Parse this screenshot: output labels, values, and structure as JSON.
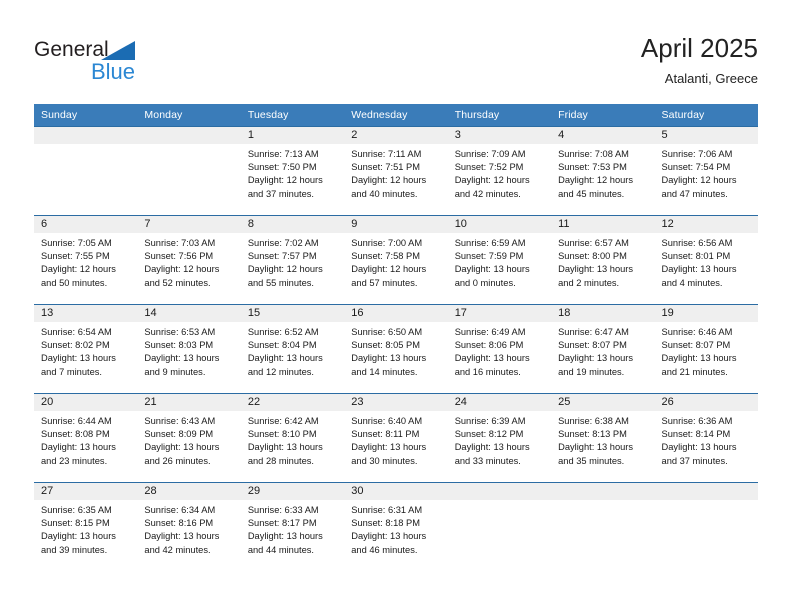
{
  "brand": {
    "name_part1": "General",
    "name_part2": "Blue"
  },
  "header": {
    "title": "April 2025",
    "subtitle": "Atalanti, Greece"
  },
  "colors": {
    "header_blue": "#3a7cb9",
    "row_rule_blue": "#2b6ca3",
    "daynum_band": "#efefef",
    "logo_blue": "#2b87d3",
    "logo_triangle": "#1b6cb3"
  },
  "weekdays": [
    "Sunday",
    "Monday",
    "Tuesday",
    "Wednesday",
    "Thursday",
    "Friday",
    "Saturday"
  ],
  "weeks": [
    [
      {
        "day": "",
        "lines": []
      },
      {
        "day": "",
        "lines": []
      },
      {
        "day": "1",
        "lines": [
          "Sunrise: 7:13 AM",
          "Sunset: 7:50 PM",
          "Daylight: 12 hours",
          "and 37 minutes."
        ]
      },
      {
        "day": "2",
        "lines": [
          "Sunrise: 7:11 AM",
          "Sunset: 7:51 PM",
          "Daylight: 12 hours",
          "and 40 minutes."
        ]
      },
      {
        "day": "3",
        "lines": [
          "Sunrise: 7:09 AM",
          "Sunset: 7:52 PM",
          "Daylight: 12 hours",
          "and 42 minutes."
        ]
      },
      {
        "day": "4",
        "lines": [
          "Sunrise: 7:08 AM",
          "Sunset: 7:53 PM",
          "Daylight: 12 hours",
          "and 45 minutes."
        ]
      },
      {
        "day": "5",
        "lines": [
          "Sunrise: 7:06 AM",
          "Sunset: 7:54 PM",
          "Daylight: 12 hours",
          "and 47 minutes."
        ]
      }
    ],
    [
      {
        "day": "6",
        "lines": [
          "Sunrise: 7:05 AM",
          "Sunset: 7:55 PM",
          "Daylight: 12 hours",
          "and 50 minutes."
        ]
      },
      {
        "day": "7",
        "lines": [
          "Sunrise: 7:03 AM",
          "Sunset: 7:56 PM",
          "Daylight: 12 hours",
          "and 52 minutes."
        ]
      },
      {
        "day": "8",
        "lines": [
          "Sunrise: 7:02 AM",
          "Sunset: 7:57 PM",
          "Daylight: 12 hours",
          "and 55 minutes."
        ]
      },
      {
        "day": "9",
        "lines": [
          "Sunrise: 7:00 AM",
          "Sunset: 7:58 PM",
          "Daylight: 12 hours",
          "and 57 minutes."
        ]
      },
      {
        "day": "10",
        "lines": [
          "Sunrise: 6:59 AM",
          "Sunset: 7:59 PM",
          "Daylight: 13 hours",
          "and 0 minutes."
        ]
      },
      {
        "day": "11",
        "lines": [
          "Sunrise: 6:57 AM",
          "Sunset: 8:00 PM",
          "Daylight: 13 hours",
          "and 2 minutes."
        ]
      },
      {
        "day": "12",
        "lines": [
          "Sunrise: 6:56 AM",
          "Sunset: 8:01 PM",
          "Daylight: 13 hours",
          "and 4 minutes."
        ]
      }
    ],
    [
      {
        "day": "13",
        "lines": [
          "Sunrise: 6:54 AM",
          "Sunset: 8:02 PM",
          "Daylight: 13 hours",
          "and 7 minutes."
        ]
      },
      {
        "day": "14",
        "lines": [
          "Sunrise: 6:53 AM",
          "Sunset: 8:03 PM",
          "Daylight: 13 hours",
          "and 9 minutes."
        ]
      },
      {
        "day": "15",
        "lines": [
          "Sunrise: 6:52 AM",
          "Sunset: 8:04 PM",
          "Daylight: 13 hours",
          "and 12 minutes."
        ]
      },
      {
        "day": "16",
        "lines": [
          "Sunrise: 6:50 AM",
          "Sunset: 8:05 PM",
          "Daylight: 13 hours",
          "and 14 minutes."
        ]
      },
      {
        "day": "17",
        "lines": [
          "Sunrise: 6:49 AM",
          "Sunset: 8:06 PM",
          "Daylight: 13 hours",
          "and 16 minutes."
        ]
      },
      {
        "day": "18",
        "lines": [
          "Sunrise: 6:47 AM",
          "Sunset: 8:07 PM",
          "Daylight: 13 hours",
          "and 19 minutes."
        ]
      },
      {
        "day": "19",
        "lines": [
          "Sunrise: 6:46 AM",
          "Sunset: 8:07 PM",
          "Daylight: 13 hours",
          "and 21 minutes."
        ]
      }
    ],
    [
      {
        "day": "20",
        "lines": [
          "Sunrise: 6:44 AM",
          "Sunset: 8:08 PM",
          "Daylight: 13 hours",
          "and 23 minutes."
        ]
      },
      {
        "day": "21",
        "lines": [
          "Sunrise: 6:43 AM",
          "Sunset: 8:09 PM",
          "Daylight: 13 hours",
          "and 26 minutes."
        ]
      },
      {
        "day": "22",
        "lines": [
          "Sunrise: 6:42 AM",
          "Sunset: 8:10 PM",
          "Daylight: 13 hours",
          "and 28 minutes."
        ]
      },
      {
        "day": "23",
        "lines": [
          "Sunrise: 6:40 AM",
          "Sunset: 8:11 PM",
          "Daylight: 13 hours",
          "and 30 minutes."
        ]
      },
      {
        "day": "24",
        "lines": [
          "Sunrise: 6:39 AM",
          "Sunset: 8:12 PM",
          "Daylight: 13 hours",
          "and 33 minutes."
        ]
      },
      {
        "day": "25",
        "lines": [
          "Sunrise: 6:38 AM",
          "Sunset: 8:13 PM",
          "Daylight: 13 hours",
          "and 35 minutes."
        ]
      },
      {
        "day": "26",
        "lines": [
          "Sunrise: 6:36 AM",
          "Sunset: 8:14 PM",
          "Daylight: 13 hours",
          "and 37 minutes."
        ]
      }
    ],
    [
      {
        "day": "27",
        "lines": [
          "Sunrise: 6:35 AM",
          "Sunset: 8:15 PM",
          "Daylight: 13 hours",
          "and 39 minutes."
        ]
      },
      {
        "day": "28",
        "lines": [
          "Sunrise: 6:34 AM",
          "Sunset: 8:16 PM",
          "Daylight: 13 hours",
          "and 42 minutes."
        ]
      },
      {
        "day": "29",
        "lines": [
          "Sunrise: 6:33 AM",
          "Sunset: 8:17 PM",
          "Daylight: 13 hours",
          "and 44 minutes."
        ]
      },
      {
        "day": "30",
        "lines": [
          "Sunrise: 6:31 AM",
          "Sunset: 8:18 PM",
          "Daylight: 13 hours",
          "and 46 minutes."
        ]
      },
      {
        "day": "",
        "lines": []
      },
      {
        "day": "",
        "lines": []
      },
      {
        "day": "",
        "lines": []
      }
    ]
  ]
}
